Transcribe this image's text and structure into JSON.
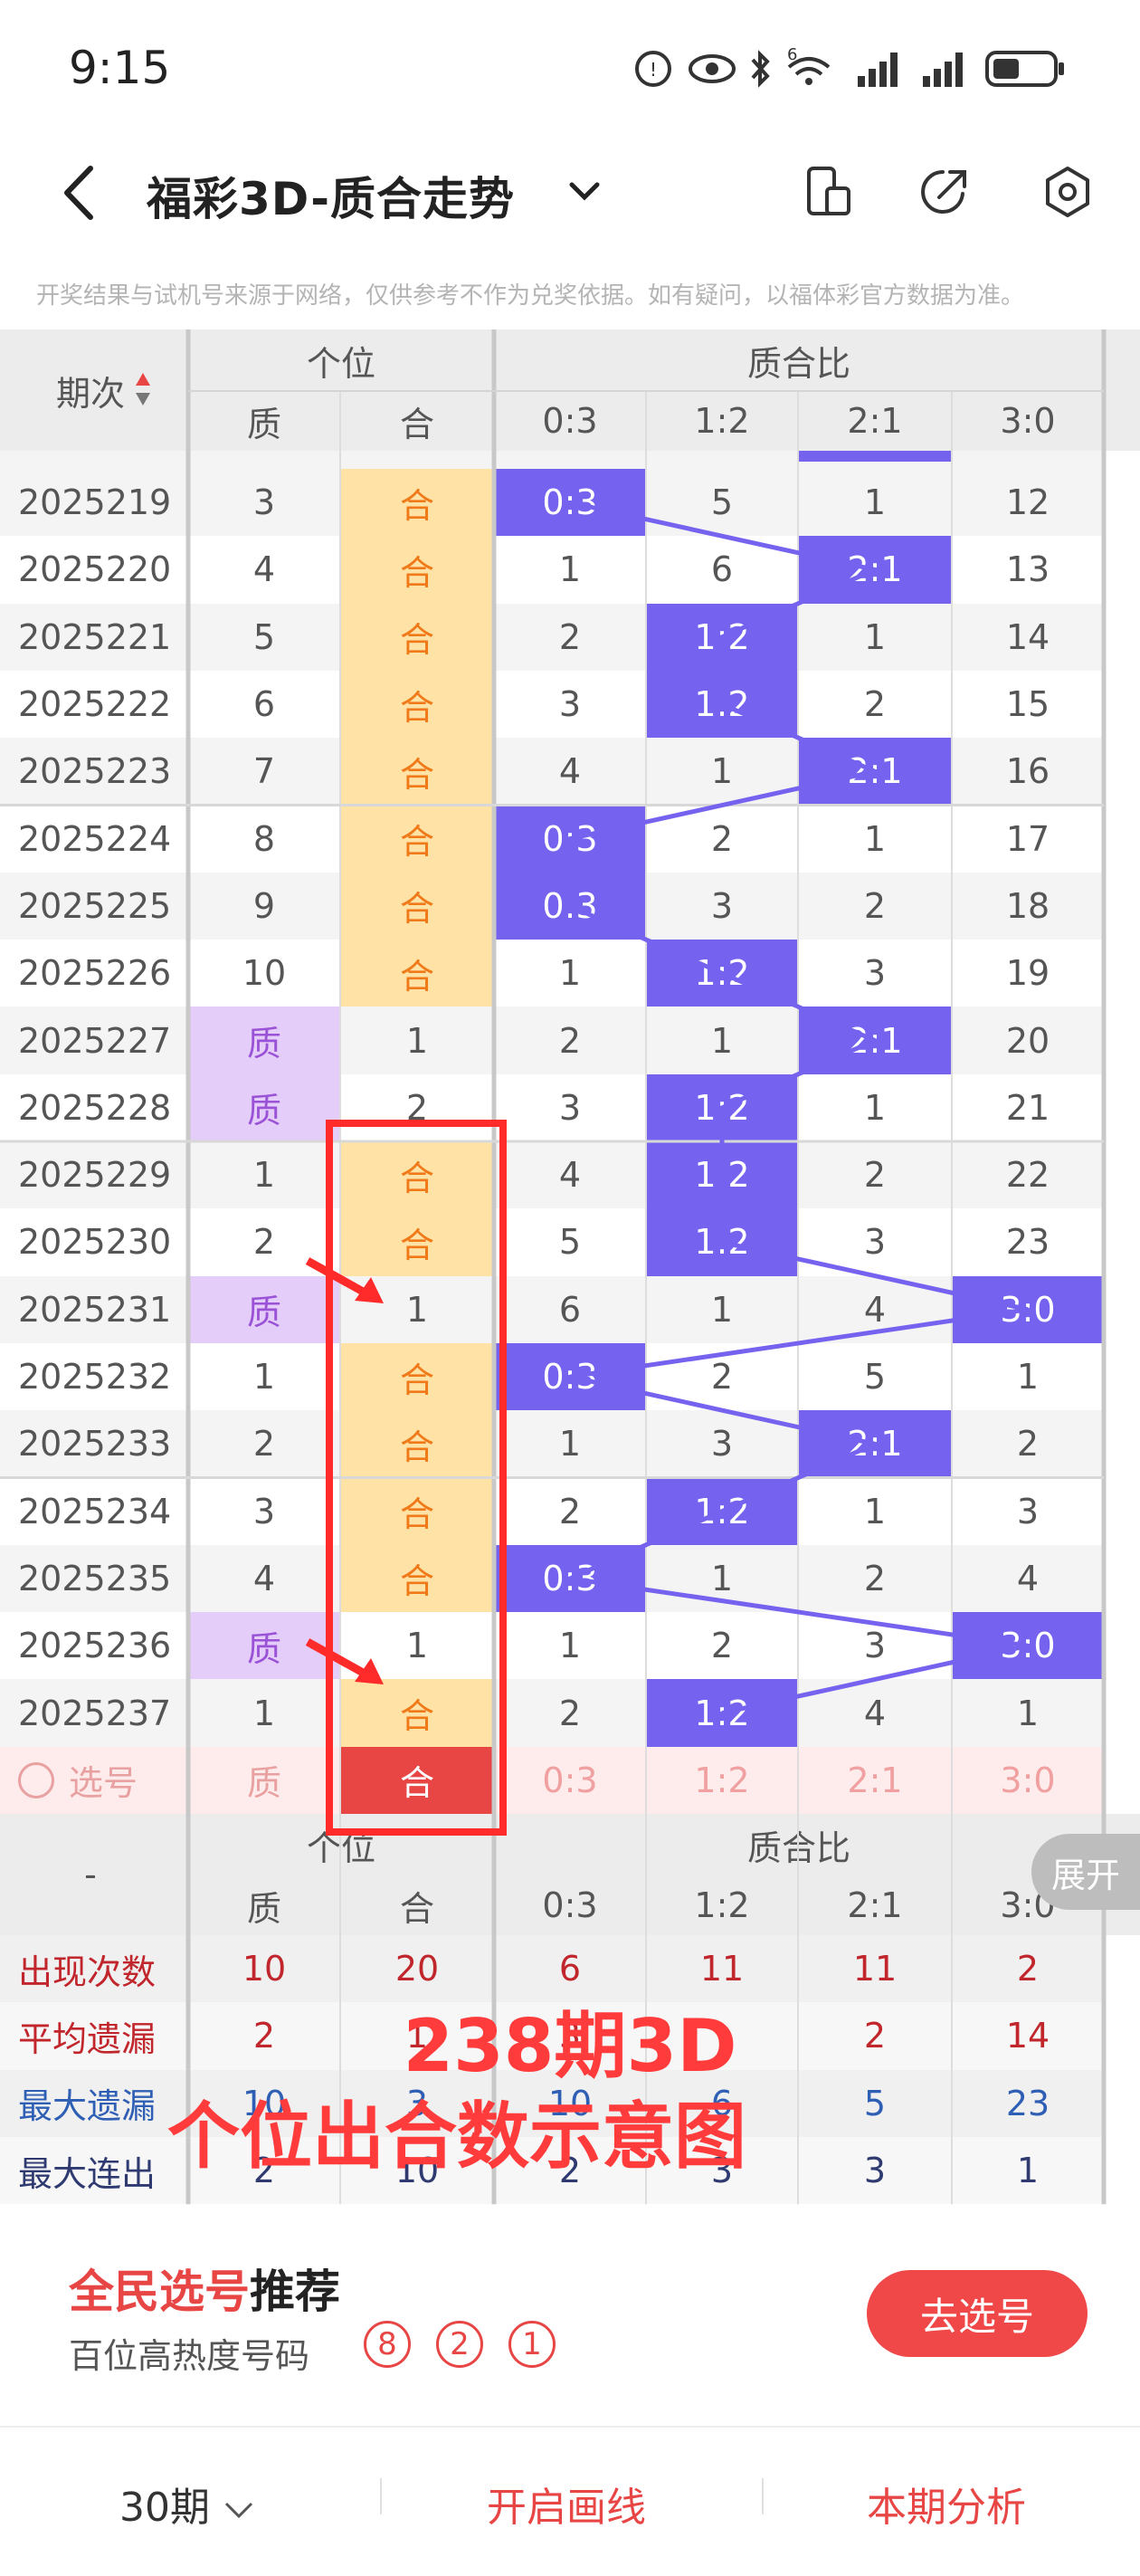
{
  "status_bar": {
    "time": "9:15",
    "signal_label": "6"
  },
  "header": {
    "title": "福彩3D-质合走势"
  },
  "notice": "开奖结果与试机号来源于网络，仅供参考不作为兑奖依据。如有疑问，以福体彩官方数据为准。",
  "table": {
    "col_period": "期次",
    "group_digit": "个位",
    "group_ratio": "质合比",
    "sub_digit": [
      "质",
      "合"
    ],
    "sub_ratio": [
      "0:3",
      "1:2",
      "2:1",
      "3:0"
    ],
    "rows": [
      {
        "p": "2025219",
        "z": "3",
        "h": "合",
        "r": [
          "0:3",
          "5",
          "1",
          "12"
        ],
        "zh": "h",
        "ri": 0
      },
      {
        "p": "2025220",
        "z": "4",
        "h": "合",
        "r": [
          "1",
          "6",
          "2:1",
          "13"
        ],
        "zh": "h",
        "ri": 2
      },
      {
        "p": "2025221",
        "z": "5",
        "h": "合",
        "r": [
          "2",
          "1:2",
          "1",
          "14"
        ],
        "zh": "h",
        "ri": 1
      },
      {
        "p": "2025222",
        "z": "6",
        "h": "合",
        "r": [
          "3",
          "1:2",
          "2",
          "15"
        ],
        "zh": "h",
        "ri": 1
      },
      {
        "p": "2025223",
        "z": "7",
        "h": "合",
        "r": [
          "4",
          "1",
          "2:1",
          "16"
        ],
        "zh": "h",
        "ri": 2
      },
      {
        "p": "2025224",
        "z": "8",
        "h": "合",
        "r": [
          "0:3",
          "2",
          "1",
          "17"
        ],
        "zh": "h",
        "ri": 0
      },
      {
        "p": "2025225",
        "z": "9",
        "h": "合",
        "r": [
          "0:3",
          "3",
          "2",
          "18"
        ],
        "zh": "h",
        "ri": 0
      },
      {
        "p": "2025226",
        "z": "10",
        "h": "合",
        "r": [
          "1",
          "1:2",
          "3",
          "19"
        ],
        "zh": "h",
        "ri": 1
      },
      {
        "p": "2025227",
        "z": "质",
        "h": "1",
        "r": [
          "2",
          "1",
          "2:1",
          "20"
        ],
        "zh": "z",
        "ri": 2
      },
      {
        "p": "2025228",
        "z": "质",
        "h": "2",
        "r": [
          "3",
          "1:2",
          "1",
          "21"
        ],
        "zh": "z",
        "ri": 1
      },
      {
        "p": "2025229",
        "z": "1",
        "h": "合",
        "r": [
          "4",
          "1:2",
          "2",
          "22"
        ],
        "zh": "h",
        "ri": 1
      },
      {
        "p": "2025230",
        "z": "2",
        "h": "合",
        "r": [
          "5",
          "1:2",
          "3",
          "23"
        ],
        "zh": "h",
        "ri": 1
      },
      {
        "p": "2025231",
        "z": "质",
        "h": "1",
        "r": [
          "6",
          "1",
          "4",
          "3:0"
        ],
        "zh": "z",
        "ri": 3
      },
      {
        "p": "2025232",
        "z": "1",
        "h": "合",
        "r": [
          "0:3",
          "2",
          "5",
          "1"
        ],
        "zh": "h",
        "ri": 0
      },
      {
        "p": "2025233",
        "z": "2",
        "h": "合",
        "r": [
          "1",
          "3",
          "2:1",
          "2"
        ],
        "zh": "h",
        "ri": 2
      },
      {
        "p": "2025234",
        "z": "3",
        "h": "合",
        "r": [
          "2",
          "1:2",
          "1",
          "3"
        ],
        "zh": "h",
        "ri": 1
      },
      {
        "p": "2025235",
        "z": "4",
        "h": "合",
        "r": [
          "0:3",
          "1",
          "2",
          "4"
        ],
        "zh": "h",
        "ri": 0
      },
      {
        "p": "2025236",
        "z": "质",
        "h": "1",
        "r": [
          "1",
          "2",
          "3",
          "3:0"
        ],
        "zh": "z",
        "ri": 3
      },
      {
        "p": "2025237",
        "z": "1",
        "h": "合",
        "r": [
          "2",
          "1:2",
          "4",
          "1"
        ],
        "zh": "h",
        "ri": 1
      }
    ],
    "select_row": {
      "label": "选号",
      "z": "质",
      "h": "合",
      "r": [
        "0:3",
        "1:2",
        "2:1",
        "3:0"
      ]
    },
    "footer_dash": "-",
    "stats": [
      {
        "label": "出现次数",
        "v": [
          "10",
          "20",
          "6",
          "11",
          "11",
          "2"
        ],
        "color": "#c0262b"
      },
      {
        "label": "平均遗漏",
        "v": [
          "2",
          "1",
          "3",
          "",
          "2",
          "14"
        ],
        "color": "#c0262b"
      },
      {
        "label": "最大遗漏",
        "v": [
          "10",
          "3",
          "10",
          "6",
          "5",
          "23"
        ],
        "color": "#2f5fb5"
      },
      {
        "label": "最大连出",
        "v": [
          "2",
          "10",
          "2",
          "3",
          "3",
          "1"
        ],
        "color": "#2f3b70"
      }
    ],
    "expand_label": "展开"
  },
  "overlay": {
    "line1": "238期3D",
    "line2": "个位出合数示意图"
  },
  "recommend": {
    "title_a": "全民选号",
    "title_b": "推荐",
    "subtitle": "百位高热度号码",
    "balls": [
      "8",
      "2",
      "1"
    ],
    "button": "去选号"
  },
  "bottom_bar": {
    "periods": "30期",
    "draw_line": "开启画线",
    "analysis": "本期分析"
  },
  "colors": {
    "accent_red": "#e84545",
    "ratio_purple": "#7563f0",
    "he_orange_bg": "#ffe3a6",
    "zhi_purple_bg": "#e5cdfa"
  }
}
